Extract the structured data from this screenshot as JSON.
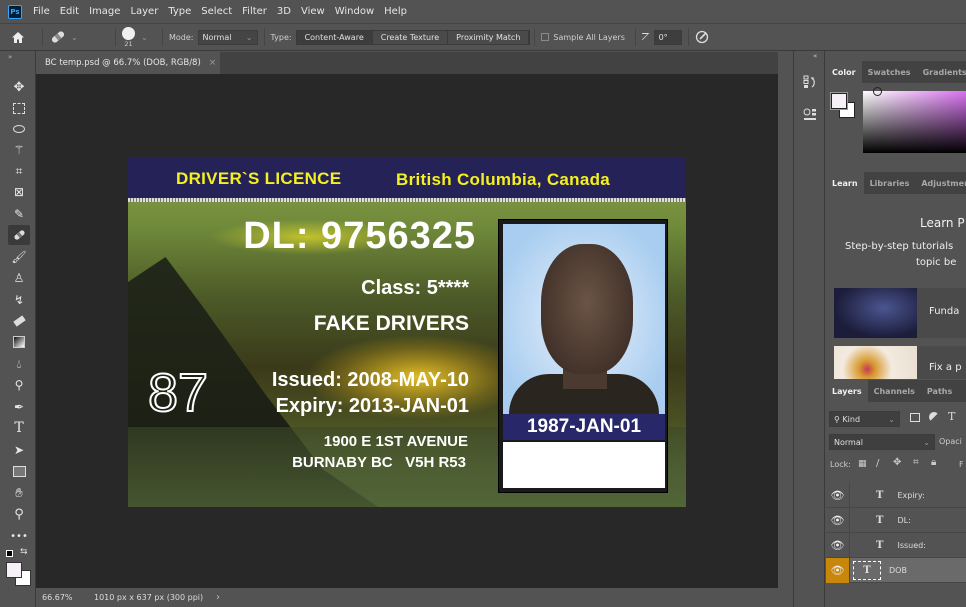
{
  "app": {
    "logo": "Ps",
    "title": "Adobe Photoshop"
  },
  "menu": [
    "File",
    "Edit",
    "Image",
    "Layer",
    "Type",
    "Select",
    "Filter",
    "3D",
    "View",
    "Window",
    "Help"
  ],
  "options": {
    "brush_size": "21",
    "mode_label": "Mode:",
    "mode_value": "Normal",
    "type_label": "Type:",
    "type_options": [
      "Content-Aware",
      "Create Texture",
      "Proximity Match"
    ],
    "type_selected": "Content-Aware",
    "sample_all_layers": "Sample All Layers",
    "sample_all_checked": false,
    "angle_value": "0°"
  },
  "document": {
    "tab_title": "BC temp.psd @ 66.7% (DOB, RGB/8)",
    "zoom": "66.67%",
    "doc_info": "1010 px x 637 px (300 ppi)"
  },
  "card": {
    "title": "DRIVER`S LICENCE",
    "region": "British Columbia, Canada",
    "dl": "DL:  9756325",
    "class": "Class:  5****",
    "name": "FAKE DRIVERS",
    "ghost_number": "87",
    "issued": "Issued:  2008-MAY-10",
    "expiry": "Expiry:  2013-JAN-01",
    "address1": "1900 E 1ST AVENUE",
    "address2": "BURNABY BC   V5H R53",
    "dob": "1987-JAN-01",
    "header_color": "#242257",
    "title_color": "#f5f020"
  },
  "tools": [
    "move-tool",
    "marquee-tool",
    "lasso-tool",
    "magic-wand-tool",
    "crop-tool",
    "frame-tool",
    "eyedropper-tool",
    "healing-brush-tool",
    "brush-tool",
    "clone-stamp-tool",
    "history-brush-tool",
    "eraser-tool",
    "gradient-tool",
    "blur-tool",
    "dodge-tool",
    "pen-tool",
    "type-tool",
    "path-selection-tool",
    "rectangle-tool",
    "hand-tool",
    "zoom-tool",
    "more-tools"
  ],
  "active_tool": "healing-brush-tool",
  "panels": {
    "color_tabs": [
      "Color",
      "Swatches",
      "Gradients"
    ],
    "color_active": "Color",
    "foreground_color": "#f7f0f7",
    "background_color": "#ffffff",
    "learn_tabs": [
      "Learn",
      "Libraries",
      "Adjustments"
    ],
    "learn_active": "Learn",
    "learn_heading": "Learn P",
    "learn_sub1": "Step-by-step tutorials",
    "learn_sub2": "topic be",
    "tutorials": [
      "Funda",
      "Fix a p"
    ],
    "layers_tabs": [
      "Layers",
      "Channels",
      "Paths"
    ],
    "layers_active": "Layers",
    "filter_kind": "Kind",
    "blend_mode": "Normal",
    "opacity_label": "Opaci",
    "lock_label": "Lock:",
    "fill_label": "F",
    "layers": [
      {
        "name": "Expiry:",
        "type": "T",
        "visible": true,
        "selected": false
      },
      {
        "name": "DL:",
        "type": "T",
        "visible": true,
        "selected": false
      },
      {
        "name": "Issued:",
        "type": "T",
        "visible": true,
        "selected": false
      },
      {
        "name": "DOB",
        "type": "T",
        "visible": true,
        "selected": true
      }
    ],
    "selected_eye_color": "#c8860b"
  }
}
